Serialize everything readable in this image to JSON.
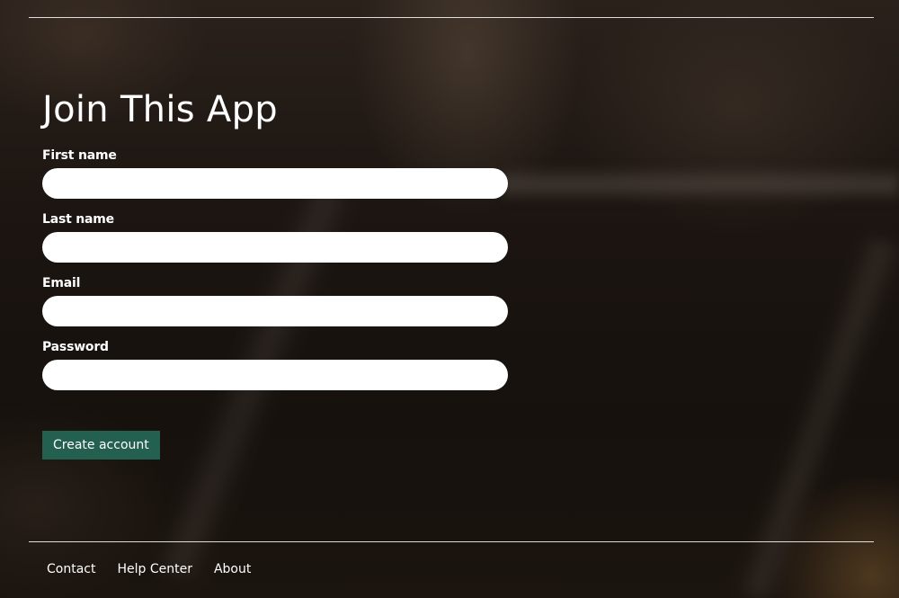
{
  "page": {
    "title": "Join This App"
  },
  "form": {
    "fields": [
      {
        "label": "First name",
        "value": "",
        "placeholder": ""
      },
      {
        "label": "Last name",
        "value": "",
        "placeholder": ""
      },
      {
        "label": "Email",
        "value": "",
        "placeholder": ""
      },
      {
        "label": "Password",
        "value": "",
        "placeholder": ""
      }
    ],
    "submit_label": "Create account"
  },
  "footer": {
    "links": [
      "Contact",
      "Help Center",
      "About"
    ]
  },
  "colors": {
    "button_bg": "#23604f",
    "input_bg": "#ffffff",
    "text": "#ffffff"
  }
}
